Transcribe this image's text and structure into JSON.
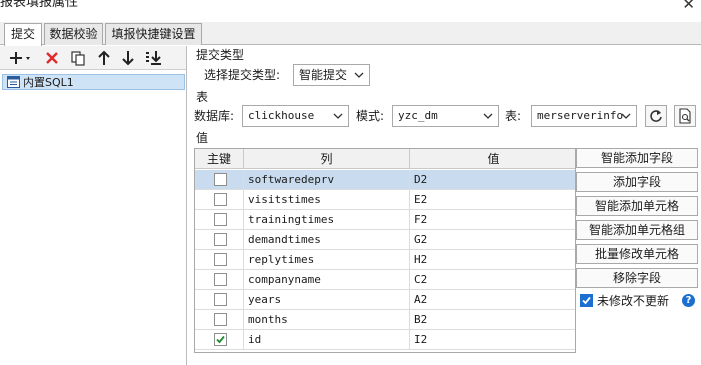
{
  "window": {
    "title": "报表填报属性"
  },
  "tabs": [
    {
      "label": "提交",
      "active": true
    },
    {
      "label": "数据校验",
      "active": false
    },
    {
      "label": "填报快捷键设置",
      "active": false
    }
  ],
  "left": {
    "toolbar_icons": [
      "add-dropdown-icon",
      "delete-icon",
      "copy-icon",
      "move-up-icon",
      "move-down-icon",
      "move-bottom-icon"
    ],
    "items": [
      {
        "label": "内置SQL1",
        "icon": "sql-item-icon",
        "selected": true
      }
    ]
  },
  "submit_type": {
    "section_label": "提交类型",
    "select_label": "选择提交类型:",
    "value": "智能提交"
  },
  "table_section": {
    "section_label": "表",
    "database_label": "数据库:",
    "database_value": "clickhouse",
    "schema_label": "模式:",
    "schema_value": "yzc_dm",
    "table_label": "表:",
    "table_value": "merserverinfo"
  },
  "values_section": {
    "section_label": "值",
    "columns": [
      "主键",
      "列",
      "值"
    ],
    "rows": [
      {
        "key": false,
        "column": "softwaredeprv",
        "value": "D2",
        "selected": true
      },
      {
        "key": false,
        "column": "visitstimes",
        "value": "E2",
        "selected": false
      },
      {
        "key": false,
        "column": "trainingtimes",
        "value": "F2",
        "selected": false
      },
      {
        "key": false,
        "column": "demandtimes",
        "value": "G2",
        "selected": false
      },
      {
        "key": false,
        "column": "replytimes",
        "value": "H2",
        "selected": false
      },
      {
        "key": false,
        "column": "companyname",
        "value": "C2",
        "selected": false
      },
      {
        "key": false,
        "column": "years",
        "value": "A2",
        "selected": false
      },
      {
        "key": false,
        "column": "months",
        "value": "B2",
        "selected": false
      },
      {
        "key": true,
        "column": "id",
        "value": "I2",
        "selected": false
      }
    ]
  },
  "actions": {
    "smart_add_field": "智能添加字段",
    "add_field": "添加字段",
    "smart_add_cell": "智能添加单元格",
    "smart_add_cell_group": "智能添加单元格组",
    "batch_edit_cell": "批量修改单元格",
    "remove_field": "移除字段",
    "no_update_unmodified": "未修改不更新",
    "no_update_checked": true
  },
  "colors": {
    "accent": "#1c6fd0",
    "selected_row": "#c9dcef",
    "selected_item": "#cfe3f7"
  }
}
